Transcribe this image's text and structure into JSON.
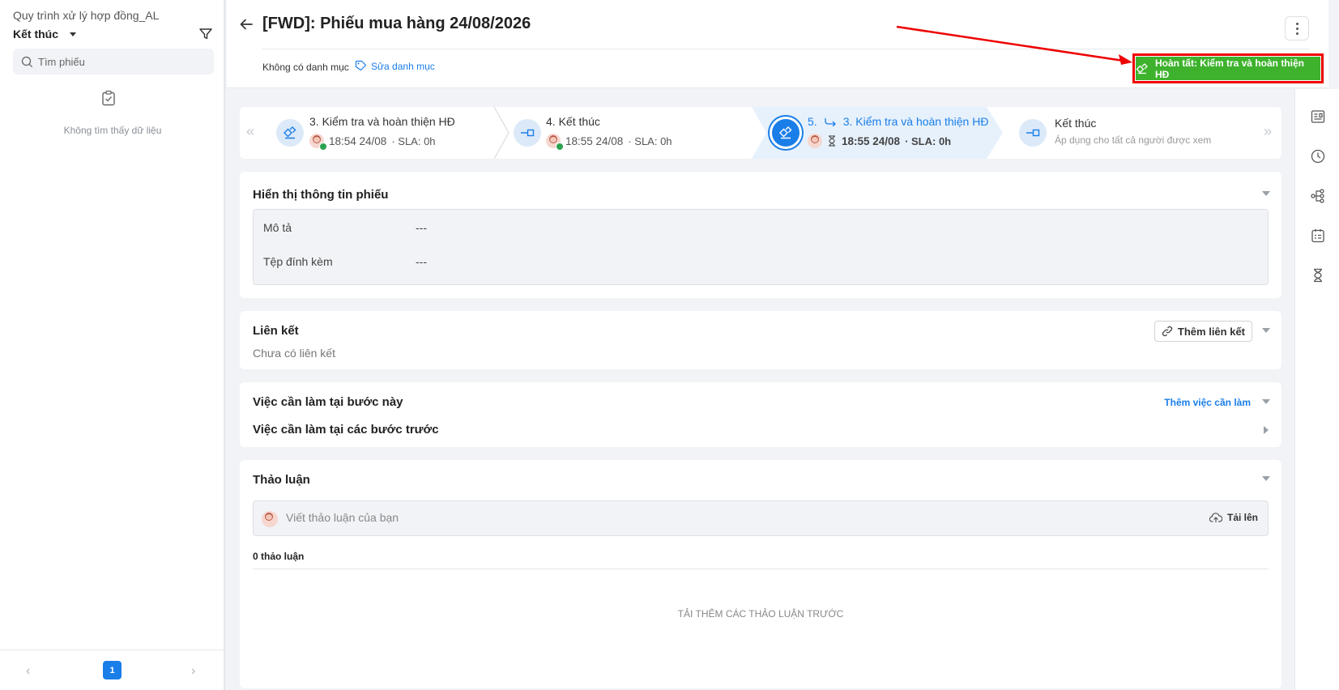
{
  "sidebar": {
    "process_name": "Quy trình xử lý hợp đồng_AL",
    "status_filter": "Kết thúc",
    "search_placeholder": "Tìm phiếu",
    "empty_text": "Không tìm thấy dữ liệu",
    "pager": {
      "current_page": "1",
      "prev": "‹",
      "next": "›"
    }
  },
  "header": {
    "title": "[FWD]: Phiếu mua hàng 24/08/2026",
    "no_category": "Không có danh mục",
    "edit_category": "Sửa danh mục",
    "complete_button": "Hoàn tất: Kiểm tra và hoàn thiện HĐ",
    "annotation_arrow_color": "#e00000"
  },
  "workflow": {
    "nav_prev": "«",
    "nav_next": "»",
    "steps": [
      {
        "title": "3. Kiểm tra và hoàn thiện HĐ",
        "time": "18:54 24/08",
        "sla": "· SLA: 0h",
        "icon": "signature-icon",
        "state": "done"
      },
      {
        "title": "4. Kết thúc",
        "time": "18:55 24/08",
        "sla": "· SLA: 0h",
        "icon": "end-icon",
        "state": "done"
      },
      {
        "number": "5.",
        "title": "3. Kiểm tra và hoàn thiện HĐ",
        "time": "18:55 24/08",
        "sla": "· SLA: 0h",
        "icon": "signature-icon",
        "state": "active"
      },
      {
        "title": "Kết thúc",
        "subtitle": "Áp dụng cho tất cả người được xem",
        "icon": "end-icon",
        "state": "pending"
      }
    ]
  },
  "info_section": {
    "title": "Hiển thị thông tin phiếu",
    "fields": [
      {
        "label": "Mô tả",
        "value": "---"
      },
      {
        "label": "Tệp đính kèm",
        "value": "---"
      }
    ]
  },
  "links_section": {
    "title": "Liên kết",
    "add_button": "Thêm liên kết",
    "empty_text": "Chưa có liên kết"
  },
  "tasks_section": {
    "current_title": "Việc cần làm tại bước này",
    "add_task": "Thêm việc cần làm",
    "previous_title": "Việc cần làm tại các bước trước"
  },
  "discussion_section": {
    "title": "Thảo luận",
    "input_placeholder": "Viết thảo luận của bạn",
    "upload": "Tải lên",
    "count": "0 thảo luận",
    "load_more": "TẢI THÊM CÁC THẢO LUẬN TRƯỚC"
  },
  "colors": {
    "accent": "#1a7ee8",
    "complete_green": "#3eb22d",
    "highlight_red": "#e00000"
  }
}
